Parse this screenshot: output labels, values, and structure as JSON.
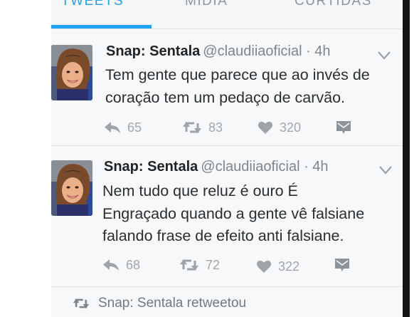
{
  "tabs": [
    {
      "label": "TWEETS",
      "active": true
    },
    {
      "label": "MÍDIA",
      "active": false
    },
    {
      "label": "CURTIDAS",
      "active": false
    }
  ],
  "tweets": [
    {
      "author_name": "Snap: Sentala",
      "author_meta": "@claudiiaoficial · 4h",
      "text_lines": [
        "Tem gente que parece que ao invés de",
        "coração tem um pedaço de carvão."
      ],
      "reply_count": "65",
      "retweet_count": "83",
      "like_count": "320"
    },
    {
      "author_name": "Snap: Sentala",
      "author_meta": "@claudiiaoficial · 4h",
      "text_lines": [
        "Nem tudo que reluz é ouro  É",
        "Engraçado quando a gente vê falsiane",
        "falando frase de efeito anti falsiane."
      ],
      "reply_count": "68",
      "retweet_count": "72",
      "like_count": "322"
    }
  ],
  "retweet_notice": "Snap: Sentala retweetou",
  "colors": {
    "accent": "#1da1f2",
    "text": "#2a2e31",
    "muted": "#a1a7ac"
  },
  "icons": [
    "reply-icon",
    "retweet-icon",
    "heart-icon",
    "dm-icon",
    "chevron-down-icon",
    "avatar-photo"
  ]
}
